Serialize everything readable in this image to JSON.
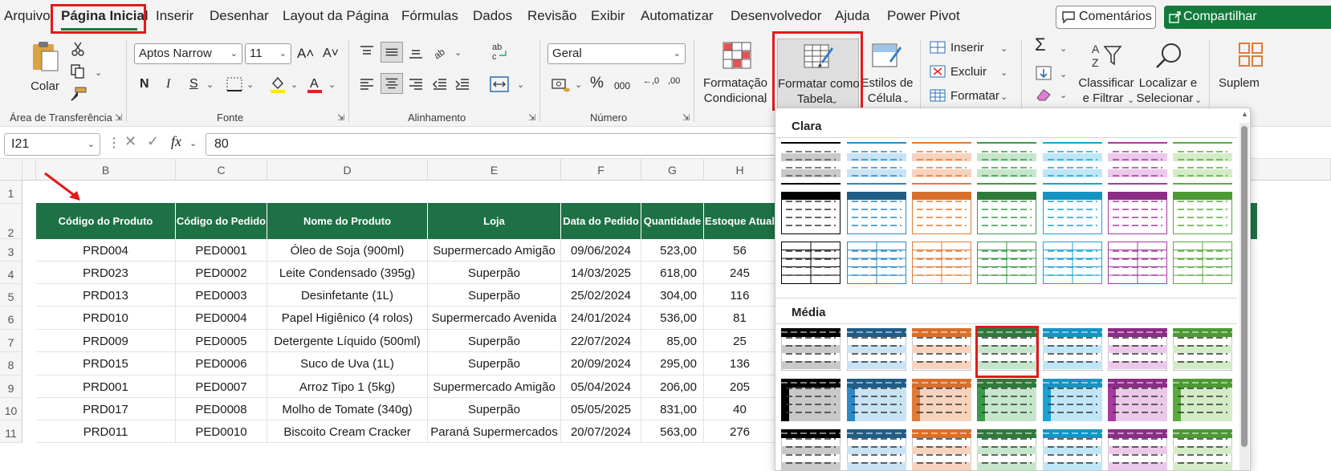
{
  "menu": {
    "tabs": [
      "Arquivo",
      "Página Inicial",
      "Inserir",
      "Desenhar",
      "Layout da Página",
      "Fórmulas",
      "Dados",
      "Revisão",
      "Exibir",
      "Automatizar",
      "Desenvolvedor",
      "Ajuda",
      "Power Pivot"
    ],
    "active": "Página Inicial",
    "comments_label": "Comentários",
    "share_label": "Compartilhar"
  },
  "ribbon": {
    "clipboard": {
      "paste_label": "Colar",
      "group_label": "Área de Transferência"
    },
    "font": {
      "name": "Aptos Narrow",
      "size": "11",
      "bold": "N",
      "italic": "I",
      "underline": "S",
      "group_label": "Fonte"
    },
    "alignment": {
      "group_label": "Alinhamento"
    },
    "number": {
      "format": "Geral",
      "percent": "%",
      "thousands": "000",
      "dec_inc": "←,0",
      "dec_dec": ",00",
      "group_label": "Número"
    },
    "styles": {
      "conditional_line1": "Formatação",
      "conditional_line2": "Condicional",
      "table_line1": "Formatar como",
      "table_line2": "Tabela",
      "cell_line1": "Estilos de",
      "cell_line2": "Célula"
    },
    "cells": {
      "insert": "Inserir",
      "delete": "Excluir",
      "format": "Formatar"
    },
    "editing": {
      "sort_line1": "Classificar",
      "sort_line2": "e Filtrar",
      "find_line1": "Localizar e",
      "find_line2": "Selecionar"
    },
    "addins_label": "Suplem"
  },
  "formula_bar": {
    "name_box": "I21",
    "fx": "fx",
    "value": "80"
  },
  "sheet": {
    "columns": [
      "B",
      "C",
      "D",
      "E",
      "F",
      "G",
      "H"
    ],
    "rows": [
      "1",
      "2",
      "3",
      "4",
      "5",
      "6",
      "7",
      "8",
      "9",
      "10",
      "11"
    ],
    "headers": [
      "Código do Produto",
      "Código do Pedido",
      "Nome do Produto",
      "Loja",
      "Data do Pedido",
      "Quantidade",
      "Estoque Atual"
    ],
    "data": [
      [
        "PRD004",
        "PED0001",
        "Óleo de Soja (900ml)",
        "Supermercado Amigão",
        "09/06/2024",
        "523,00",
        "56"
      ],
      [
        "PRD023",
        "PED0002",
        "Leite Condensado (395g)",
        "Superpão",
        "14/03/2025",
        "618,00",
        "245"
      ],
      [
        "PRD013",
        "PED0003",
        "Desinfetante (1L)",
        "Superpão",
        "25/02/2024",
        "304,00",
        "116"
      ],
      [
        "PRD010",
        "PED0004",
        "Papel Higiênico (4 rolos)",
        "Supermercado Avenida",
        "24/01/2024",
        "536,00",
        "81"
      ],
      [
        "PRD009",
        "PED0005",
        "Detergente Líquido (500ml)",
        "Superpão",
        "22/07/2024",
        "85,00",
        "25"
      ],
      [
        "PRD015",
        "PED0006",
        "Suco de Uva (1L)",
        "Superpão",
        "20/09/2024",
        "295,00",
        "136"
      ],
      [
        "PRD001",
        "PED0007",
        "Arroz Tipo 1 (5kg)",
        "Supermercado Amigão",
        "05/04/2024",
        "206,00",
        "205"
      ],
      [
        "PRD017",
        "PED0008",
        "Molho de Tomate (340g)",
        "Superpão",
        "05/05/2025",
        "831,00",
        "40"
      ],
      [
        "PRD011",
        "PED0010",
        "Biscoito Cream Cracker",
        "Paraná Supermercados",
        "20/07/2024",
        "563,00",
        "276"
      ]
    ]
  },
  "gallery": {
    "section_light": "Clara",
    "section_medium": "Média",
    "colors": [
      "#000000",
      "#2a89c6",
      "#e07b39",
      "#3a9a4a",
      "#18a3d6",
      "#a63a9f",
      "#5aab3c"
    ],
    "light_tints": [
      "#c9c9c9",
      "#c9e3f4",
      "#f7d3bd",
      "#c6e6cc",
      "#bfe6f6",
      "#ecc9ea",
      "#d3ecc6"
    ],
    "medium_head": [
      "#000000",
      "#1f5d87",
      "#d86f2b",
      "#2d7a3b",
      "#1594c4",
      "#8b2c86",
      "#4c9a33"
    ],
    "selected_index": 3
  },
  "accent": "#1e7145"
}
